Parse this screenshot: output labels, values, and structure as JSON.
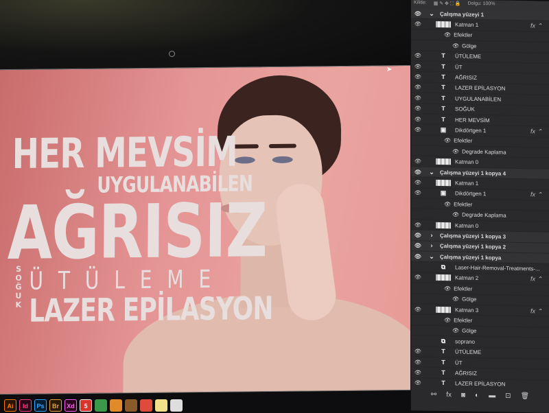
{
  "poster": {
    "line1": "HER MEVSİM",
    "line2": "UYGULANABİLEN",
    "line3": "AĞRISIZ",
    "line4": "ÜTÜLEME",
    "vertical": "SOĞUK",
    "line5": "LAZER EPİLASYON"
  },
  "panel": {
    "lock_label": "Kilitle:",
    "fill_label": "Dolgu: 100%"
  },
  "layers": [
    {
      "name": "Çalışma yüzeyi 1",
      "type": "group",
      "level": 0,
      "eye": true,
      "open": true
    },
    {
      "name": "Katman 1",
      "type": "pixel",
      "level": 1,
      "eye": true,
      "fx": true
    },
    {
      "name": "Efektler",
      "type": "effects",
      "level": 2
    },
    {
      "name": "Gölge",
      "type": "effect",
      "level": 3
    },
    {
      "name": "ÜTÜLEME",
      "type": "text",
      "level": 1,
      "eye": true
    },
    {
      "name": "ÜT",
      "type": "text",
      "level": 1,
      "eye": true
    },
    {
      "name": "AĞRISIZ",
      "type": "text",
      "level": 1,
      "eye": true
    },
    {
      "name": "LAZER EPİLASYON",
      "type": "text",
      "level": 1,
      "eye": true
    },
    {
      "name": "UYGULANABİLEN",
      "type": "text",
      "level": 1,
      "eye": true
    },
    {
      "name": "SOĞUK",
      "type": "text",
      "level": 1,
      "eye": true
    },
    {
      "name": "HER MEVSİM",
      "type": "text",
      "level": 1,
      "eye": true
    },
    {
      "name": "Dikdörtgen 1",
      "type": "shape",
      "level": 1,
      "eye": true,
      "fx": true
    },
    {
      "name": "Efektler",
      "type": "effects",
      "level": 2
    },
    {
      "name": "Degrade Kaplama",
      "type": "effect",
      "level": 3
    },
    {
      "name": "Katman 0",
      "type": "pixel",
      "level": 1,
      "eye": true
    },
    {
      "name": "Çalışma yüzeyi 1 kopya 4",
      "type": "group",
      "level": 0,
      "eye": true,
      "open": true
    },
    {
      "name": "Katman 1",
      "type": "pixel",
      "level": 1,
      "eye": true
    },
    {
      "name": "Dikdörtgen 1",
      "type": "shape",
      "level": 1,
      "eye": true,
      "fx": true
    },
    {
      "name": "Efektler",
      "type": "effects",
      "level": 2
    },
    {
      "name": "Degrade Kaplama",
      "type": "effect",
      "level": 3
    },
    {
      "name": "Katman 0",
      "type": "pixel",
      "level": 1,
      "eye": true
    },
    {
      "name": "Çalışma yüzeyi 1 kopya 3",
      "type": "group",
      "level": 0,
      "eye": true,
      "open": false
    },
    {
      "name": "Çalışma yüzeyi 1 kopya 2",
      "type": "group",
      "level": 0,
      "eye": true,
      "open": false
    },
    {
      "name": "Çalışma yüzeyi 1 kopya",
      "type": "group",
      "level": 0,
      "eye": true,
      "open": true
    },
    {
      "name": "Laser-Hair-Removal-Treatments-...",
      "type": "smart",
      "level": 1,
      "eye": false
    },
    {
      "name": "Katman 2",
      "type": "pixel",
      "level": 1,
      "eye": true,
      "fx": true
    },
    {
      "name": "Efektler",
      "type": "effects",
      "level": 2
    },
    {
      "name": "Gölge",
      "type": "effect",
      "level": 3
    },
    {
      "name": "Katman 3",
      "type": "pixel",
      "level": 1,
      "eye": true,
      "fx": true
    },
    {
      "name": "Efektler",
      "type": "effects",
      "level": 2
    },
    {
      "name": "Gölge",
      "type": "effect",
      "level": 3
    },
    {
      "name": "soprano",
      "type": "smart",
      "level": 1,
      "eye": false
    },
    {
      "name": "ÜTÜLEME",
      "type": "text",
      "level": 1,
      "eye": true
    },
    {
      "name": "ÜT",
      "type": "text",
      "level": 1,
      "eye": true
    },
    {
      "name": "AĞRISIZ",
      "type": "text",
      "level": 1,
      "eye": true
    },
    {
      "name": "LAZER EPİLASYON",
      "type": "text",
      "level": 1,
      "eye": true
    }
  ],
  "footer_icons": [
    "link-icon",
    "fx-icon",
    "mask-icon",
    "adjustment-icon",
    "folder-icon",
    "new-layer-icon",
    "trash-icon"
  ],
  "dock": [
    {
      "label": "Ai",
      "color": "#ff7c00",
      "bg": "#2b1400"
    },
    {
      "label": "Id",
      "color": "#ff3b86",
      "bg": "#2a0716"
    },
    {
      "label": "Ps",
      "color": "#31a8ff",
      "bg": "#001d34"
    },
    {
      "label": "Br",
      "color": "#e8a33a",
      "bg": "#2a1a00"
    },
    {
      "label": "Xd",
      "color": "#ff61f6",
      "bg": "#2e001f"
    },
    {
      "label": "5",
      "color": "#fff",
      "bg": "#d8342a"
    }
  ]
}
